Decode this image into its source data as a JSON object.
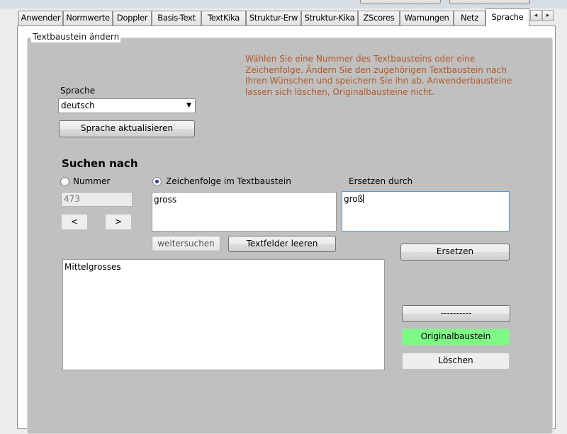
{
  "tabs": [
    "Anwender",
    "Normwerte",
    "Doppler",
    "Basis-Text",
    "TextKika",
    "Struktur-Erw",
    "Struktur-Kika",
    "ZScores",
    "Warnungen",
    "Netz",
    "Sprache"
  ],
  "active_tab": "Sprache",
  "tab_scroll": {
    "left": "◂",
    "right": "▸"
  },
  "group": {
    "title": "Textbaustein ändern"
  },
  "hint": "Wählen Sie eine Nummer des Textbausteins oder eine Zeichenfolge. Ändern Sie den zugehörigen Textbaustein nach Ihren Wünschen und speichern Sie ihn ab. Anwenderbausteine lassen sich löschen, Originalbausteine nicht.",
  "language": {
    "label": "Sprache",
    "value": "deutsch",
    "update_button": "Sprache aktualisieren"
  },
  "search": {
    "heading": "Suchen nach",
    "number_radio": "Nummer",
    "string_radio": "Zeichenfolge im Textbaustein",
    "replace_label": "Ersetzen durch",
    "number_value": "473",
    "prev_button": "<",
    "next_button": ">",
    "search_text": "gross",
    "replace_text": "groß",
    "continue_button": "weitersuchen",
    "clear_button": "Textfelder leeren"
  },
  "result_text": "Mittelgrosses",
  "actions": {
    "replace_button": "Ersetzen",
    "separator_button": "----------",
    "original_button": "Originalbaustein",
    "delete_button": "Löschen"
  },
  "colors": {
    "hint": "#b05a2a",
    "original_button_bg": "#7dfa86",
    "group_bg": "#c0c0c0"
  }
}
